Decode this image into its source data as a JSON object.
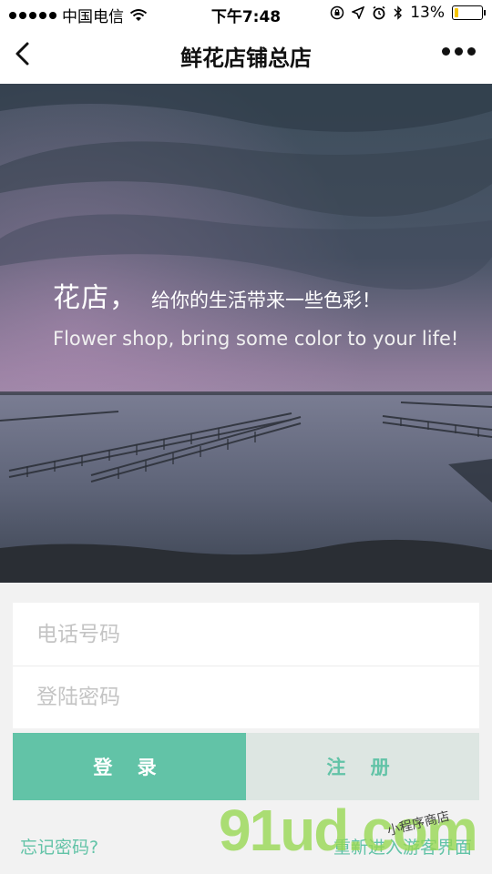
{
  "status_bar": {
    "carrier": "中国电信",
    "time": "下午7:48",
    "battery_percent": "13%",
    "battery_level": 0.13,
    "battery_color": "#f5c400"
  },
  "nav": {
    "title": "鲜花店铺总店",
    "back_icon": "chevron-left-icon",
    "more_icon": "more-dots-icon"
  },
  "hero": {
    "title": "花店，",
    "subtitle": "给你的生活带来一些色彩！",
    "subtitle_en": "Flower shop, bring some color to your life!"
  },
  "form": {
    "phone_placeholder": "电话号码",
    "phone_value": "",
    "password_placeholder": "登陆密码",
    "password_value": ""
  },
  "buttons": {
    "login": "登 录",
    "register": "注 册"
  },
  "links": {
    "forgot_password": "忘记密码?",
    "guest_mode": "重新进入游客界面"
  },
  "watermark": {
    "big": "91ud.com",
    "small": "小程序商店"
  },
  "colors": {
    "accent": "#62c3a7",
    "register_bg": "#dde6e2"
  }
}
